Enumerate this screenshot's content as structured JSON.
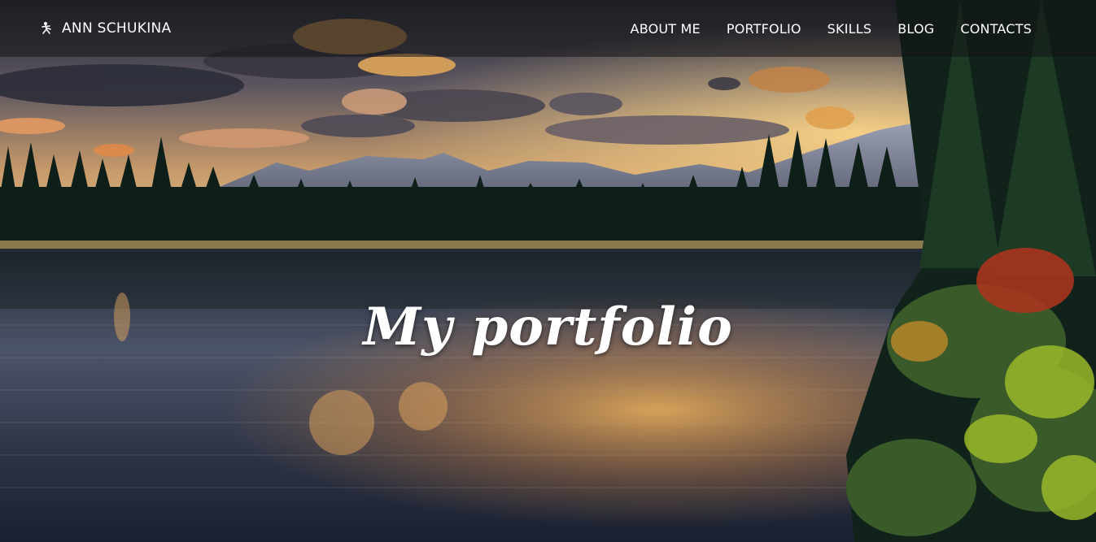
{
  "brand": {
    "name": "ANN SCHUKINA",
    "icon": "dancer-icon"
  },
  "nav": {
    "items": [
      {
        "label": "ABOUT ME"
      },
      {
        "label": "PORTFOLIO"
      },
      {
        "label": "SKILLS"
      },
      {
        "label": "BLOG"
      },
      {
        "label": "CONTACTS"
      }
    ]
  },
  "hero": {
    "title": "My portfolio"
  },
  "colors": {
    "nav_background": "#14141880",
    "text": "#ffffff"
  }
}
